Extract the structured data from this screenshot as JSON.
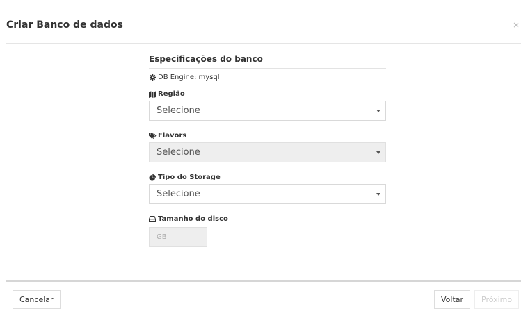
{
  "modal": {
    "title": "Criar Banco de dados",
    "close_symbol": "×"
  },
  "specs": {
    "title": "Especificações do banco",
    "engine_text": "DB Engine: mysql"
  },
  "fields": {
    "region": {
      "label": "Região",
      "value": "Selecione",
      "icon": "map-icon"
    },
    "flavors": {
      "label": "Flavors",
      "value": "Selecione",
      "icon": "tags-icon",
      "disabled": true
    },
    "storage_type": {
      "label": "Tipo do Storage",
      "value": "Selecione",
      "icon": "pie-chart-icon"
    },
    "disk_size": {
      "label": "Tamanho do disco",
      "placeholder": "GB",
      "icon": "hdd-icon",
      "disabled": true
    }
  },
  "footer": {
    "cancel_label": "Cancelar",
    "back_label": "Voltar",
    "next_label": "Próximo"
  },
  "colors": {
    "border": "#d9d9d9",
    "disabled_bg": "#eeeeee",
    "text": "#333333"
  }
}
